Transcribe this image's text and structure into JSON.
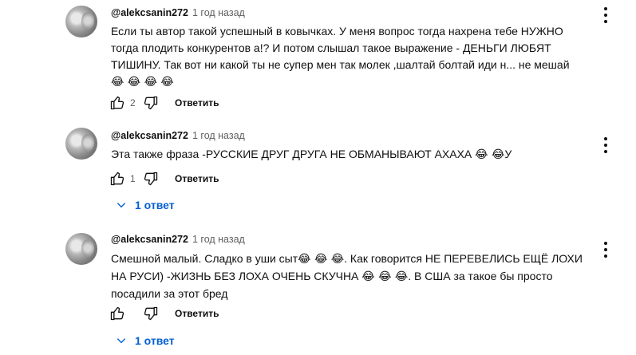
{
  "comments": [
    {
      "author": "@alekcsanin272",
      "time": "1 год назад",
      "text": "Если ты автор такой успешный в ковычках. У меня вопрос тогда нахрена тебе НУЖНО\nтогда плодить конкурентов а!? И потом слышал такое выражение - ДЕНЬГИ ЛЮБЯТ\nТИШИНУ. Так вот ни какой ты не супер мен так молек ,шалтай болтай иди н... не мешай",
      "emojis": "😂 😂 😂 😂",
      "likes": "2",
      "reply_label": "Ответить"
    },
    {
      "author": "@alekcsanin272",
      "time": "1 год назад",
      "text_before": "Эта также фраза -РУССКИЕ ДРУГ ДРУГА НЕ ОБМАНЫВАЮТ АХАХА ",
      "emojis": "😂 😂",
      "text_after": "У",
      "likes": "1",
      "reply_label": "Ответить",
      "replies_label": "1 ответ"
    },
    {
      "author": "@alekcsanin272",
      "time": "1 год назад",
      "line1_a": "Смешной малый. Сладко в уши сыт",
      "line1_emojis": "😂 😂 😂",
      "line1_b": ". Как говорится НЕ ПЕРЕВЕЛИСЬ ЕЩЁ ЛОХИ",
      "line2_a": "НА РУСИ) -ЖИЗНЬ БЕЗ ЛОХА ОЧЕНЬ СКУЧНА ",
      "line2_emojis": "😂 😂 😂",
      "line2_b": ". В США за такое бы просто",
      "line3": "посадили за этот бред",
      "likes": "",
      "reply_label": "Ответить",
      "replies_label": "1 ответ"
    }
  ],
  "icons": {
    "like": "thumb-up-icon",
    "dislike": "thumb-down-icon",
    "more": "more-vert-icon",
    "expand": "chevron-down-icon"
  },
  "colors": {
    "link_blue": "#065fd4",
    "secondary_text": "#606060",
    "primary_text": "#0f0f0f"
  }
}
